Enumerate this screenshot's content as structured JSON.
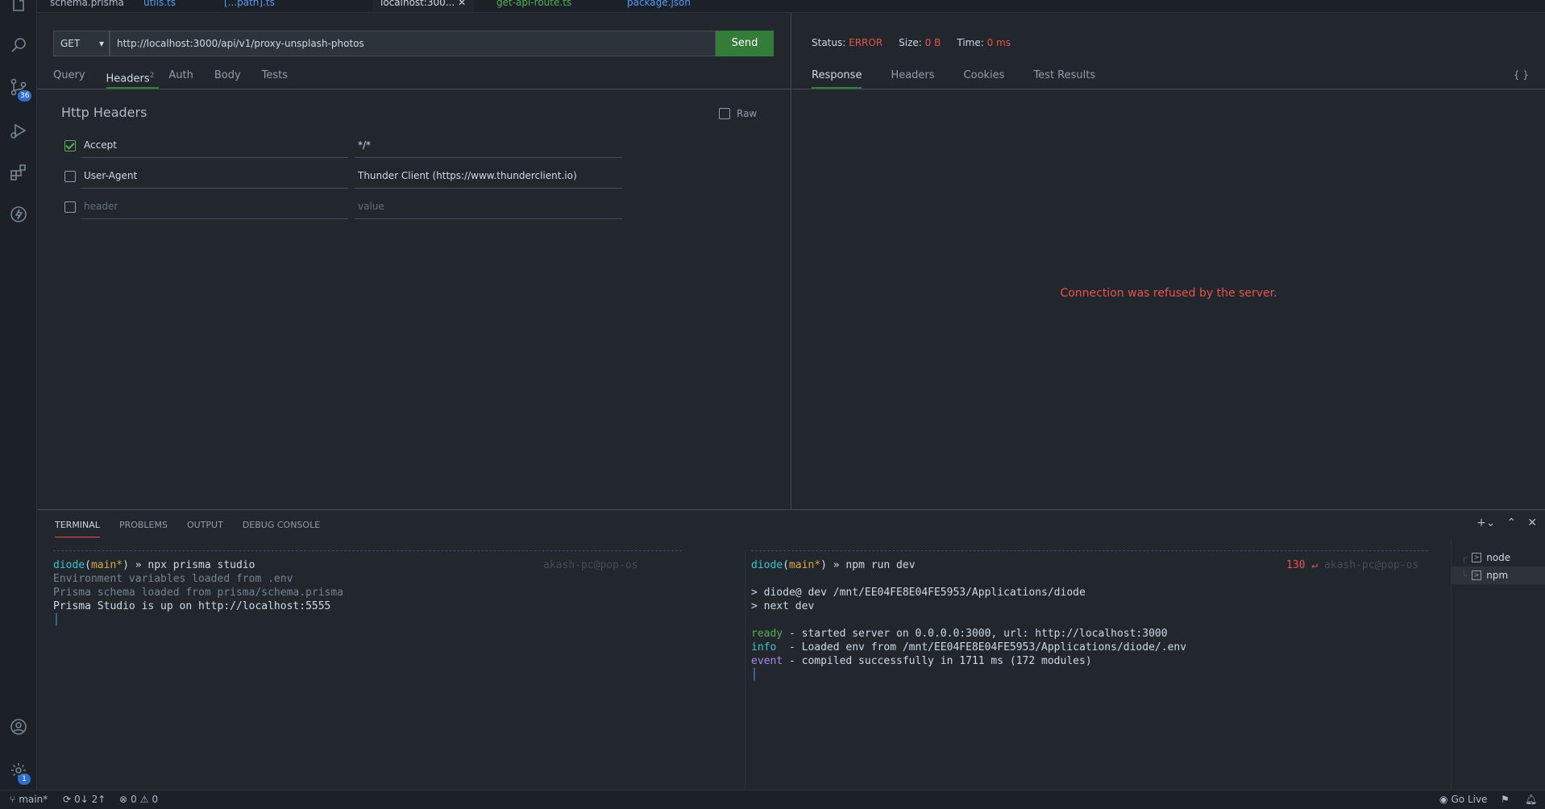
{
  "tabs": [
    {
      "label": "schema.prisma",
      "color": "#adbac7"
    },
    {
      "label": "utils.ts",
      "color": "#539bf5"
    },
    {
      "label": "[...path].ts",
      "color": "#539bf5"
    },
    {
      "label": "localhost:300...",
      "color": "#cdd9e5"
    },
    {
      "label": "get-api-route.ts",
      "color": "#57ab5a"
    },
    {
      "label": "package.json",
      "color": "#539bf5"
    }
  ],
  "activity": {
    "scm_badge": "36",
    "settings_badge": "1"
  },
  "request": {
    "method": "GET",
    "url": "http://localhost:3000/api/v1/proxy-unsplash-photos",
    "send_label": "Send",
    "subtabs": {
      "query": "Query",
      "headers": "Headers",
      "headers_count": "2",
      "auth": "Auth",
      "body": "Body",
      "tests": "Tests"
    },
    "http_headers_title": "Http Headers",
    "raw_label": "Raw",
    "headers": [
      {
        "name": "Accept",
        "value": "*/*",
        "checked": true
      },
      {
        "name": "User-Agent",
        "value": "Thunder Client (https://www.thunderclient.io)",
        "checked": false
      }
    ],
    "new_header_placeholder": "header",
    "new_value_placeholder": "value"
  },
  "response": {
    "status_label": "Status:",
    "status_value": "ERROR",
    "size_label": "Size:",
    "size_value": "0 B",
    "time_label": "Time:",
    "time_value": "0 ms",
    "tabs": {
      "response": "Response",
      "headers": "Headers",
      "cookies": "Cookies",
      "test_results": "Test Results"
    },
    "braces": "{ }",
    "message": "Connection was refused by the server."
  },
  "panel": {
    "tabs": {
      "terminal": "TERMINAL",
      "problems": "PROBLEMS",
      "output": "OUTPUT",
      "debug": "DEBUG CONSOLE"
    },
    "term1": {
      "dir": "diode",
      "branch_open": "(",
      "branch": "main",
      "dirty": "*",
      "branch_close": ")",
      "prompt": " » ",
      "cmd": "npx prisma studio",
      "host": "akash-pc@pop-os",
      "lines": [
        "Environment variables loaded from .env",
        "Prisma schema loaded from prisma/schema.prisma",
        "Prisma Studio is up on http://localhost:5555"
      ]
    },
    "term2": {
      "dir": "diode",
      "branch_open": "(",
      "branch": "main",
      "dirty": "*",
      "branch_close": ")",
      "prompt": " » ",
      "cmd": "npm run dev",
      "exit_code": "130 ↵",
      "host": "akash-pc@pop-os",
      "script_lines": [
        "> diode@ dev /mnt/EE04FE8E04FE5953/Applications/diode",
        "> next dev"
      ],
      "ready_tag": "ready",
      "ready_msg": " - started server on 0.0.0.0:3000, url: http://localhost:3000",
      "info_tag": "info",
      "info_msg": "  - Loaded env from /mnt/EE04FE8E04FE5953/Applications/diode/.env",
      "event_tag": "event",
      "event_msg": " - compiled successfully in 1711 ms (172 modules)"
    },
    "terminal_list": [
      "node",
      "npm"
    ]
  },
  "statusbar": {
    "branch": "main*",
    "sync": "0↓ 2↑",
    "errors": "0",
    "warnings": "0",
    "go_live": "Go Live"
  }
}
